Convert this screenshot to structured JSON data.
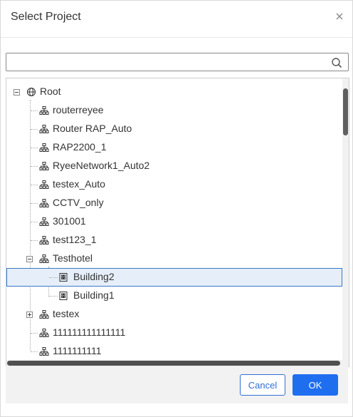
{
  "dialog": {
    "title": "Select Project",
    "close_glyph": "×",
    "search": {
      "value": "",
      "placeholder": ""
    }
  },
  "tree": {
    "root": {
      "label": "Root",
      "icon": "globe-icon",
      "expanded": true
    },
    "nodes": [
      {
        "label": "routerreyee",
        "icon": "network-icon"
      },
      {
        "label": "Router RAP_Auto",
        "icon": "network-icon"
      },
      {
        "label": "RAP2200_1",
        "icon": "network-icon"
      },
      {
        "label": "RyeeNetwork1_Auto2",
        "icon": "network-icon"
      },
      {
        "label": "testex_Auto",
        "icon": "network-icon"
      },
      {
        "label": "CCTV_only",
        "icon": "network-icon"
      },
      {
        "label": "301001",
        "icon": "network-icon"
      },
      {
        "label": "test123_1",
        "icon": "network-icon"
      },
      {
        "label": "Testhotel",
        "icon": "network-icon",
        "expanded": true,
        "children": [
          {
            "label": "Building2",
            "icon": "building-icon",
            "selected": true
          },
          {
            "label": "Building1",
            "icon": "building-icon"
          }
        ]
      },
      {
        "label": "testex",
        "icon": "network-icon",
        "expanded": false
      },
      {
        "label": "111111111111111",
        "icon": "network-icon"
      },
      {
        "label": "1111111111",
        "icon": "network-icon"
      }
    ]
  },
  "footer": {
    "cancel_label": "Cancel",
    "ok_label": "OK"
  },
  "colors": {
    "primary": "#1f6ef0",
    "selection_bg": "#e6eef9",
    "selection_border": "#3a78c9"
  }
}
